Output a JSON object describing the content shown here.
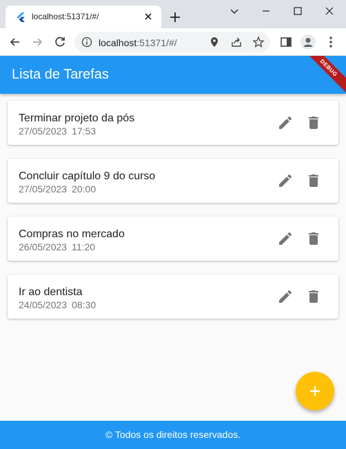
{
  "browser": {
    "tab_title": "localhost:51371/#/",
    "url_host": "localhost",
    "url_rest": ":51371/#/"
  },
  "app": {
    "title": "Lista de Tarefas",
    "debug_label": "DEBUG",
    "tasks": [
      {
        "title": "Terminar projeto da pós",
        "date": "27/05/2023",
        "time": "17:53"
      },
      {
        "title": "Concluir capítulo 9 do curso",
        "date": "27/05/2023",
        "time": "20:00"
      },
      {
        "title": "Compras no mercado",
        "date": "26/05/2023",
        "time": "11:20"
      },
      {
        "title": "Ir ao dentista",
        "date": "24/05/2023",
        "time": "08:30"
      }
    ],
    "footer": "© Todos os direitos reservados.",
    "colors": {
      "primary": "#2196f3",
      "fab": "#ffc107",
      "icon": "#757575"
    }
  }
}
